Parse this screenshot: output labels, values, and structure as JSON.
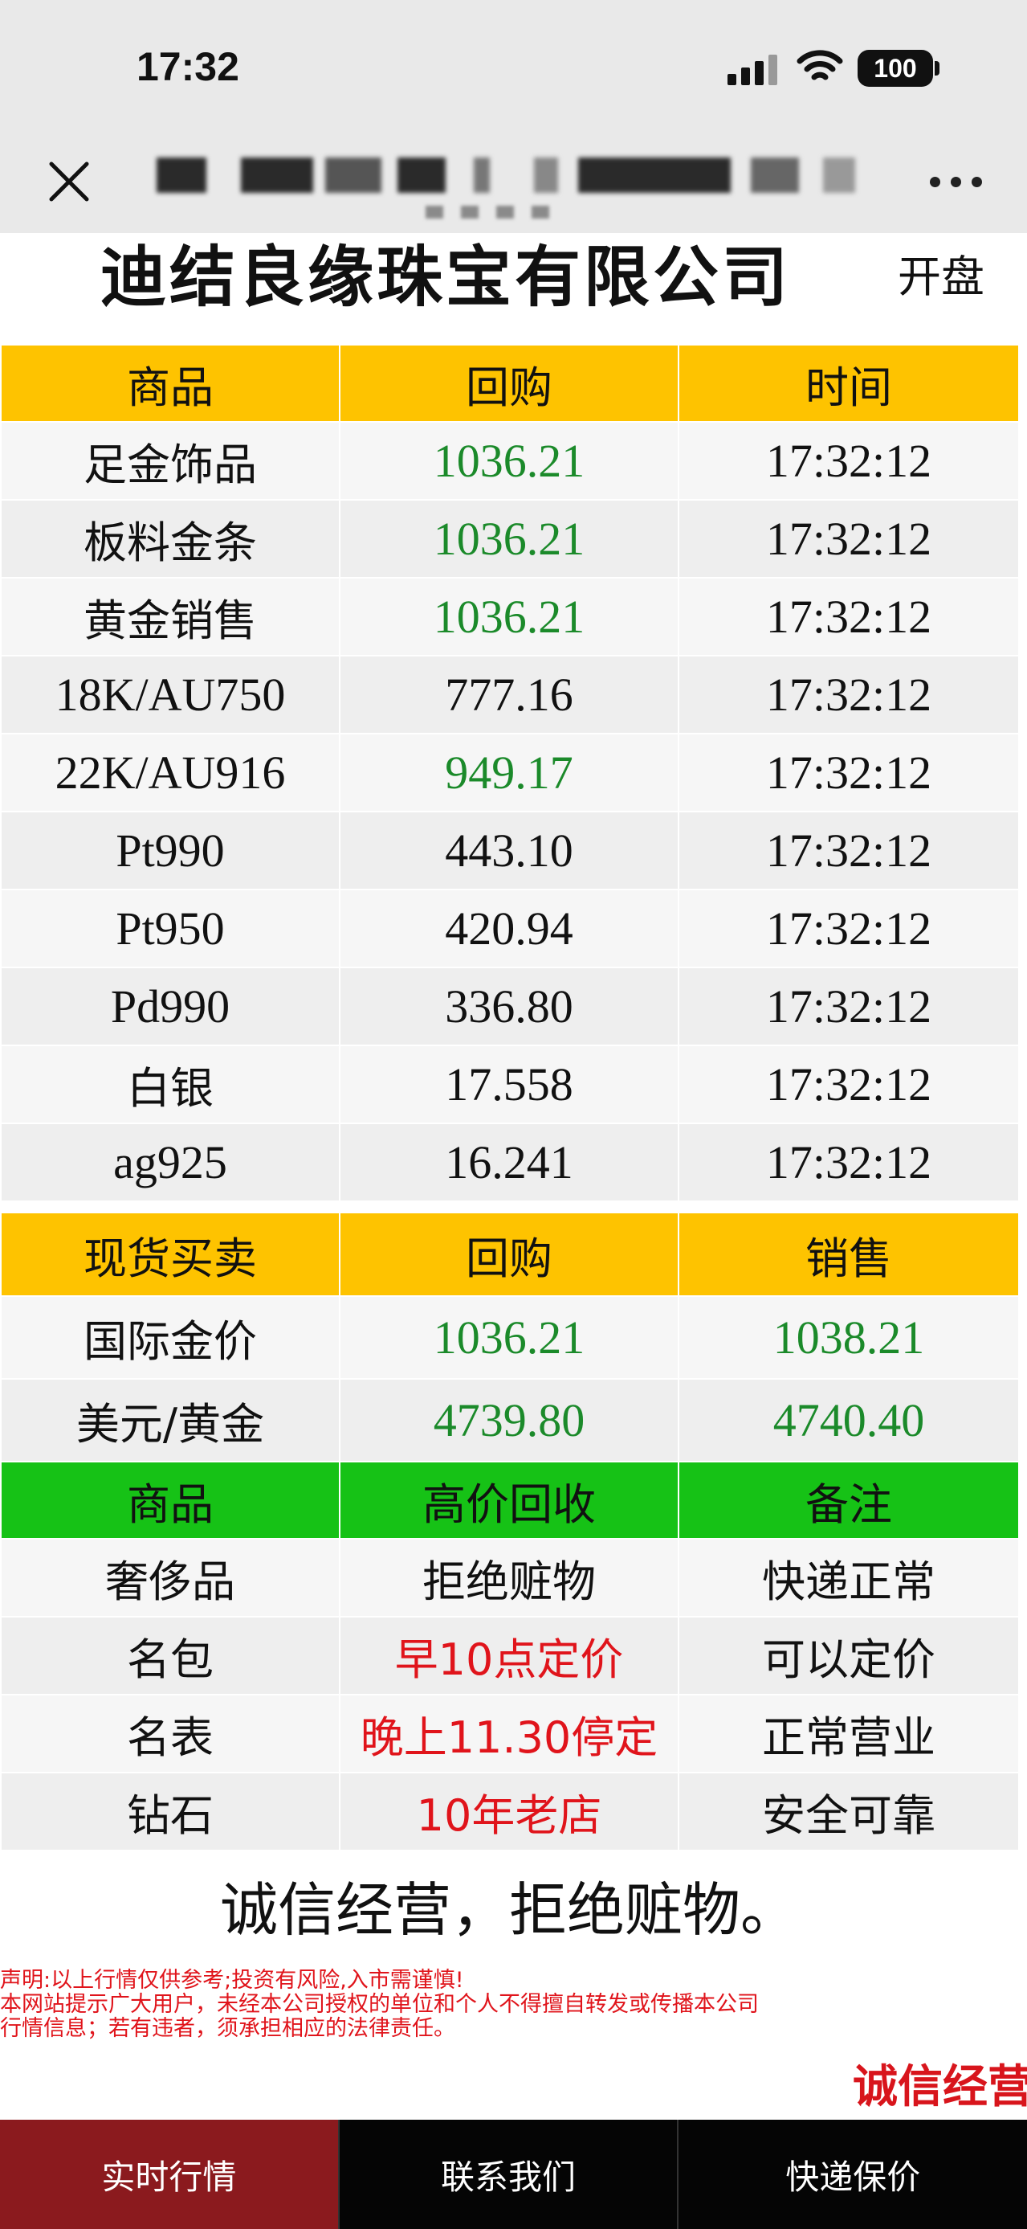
{
  "status_bar": {
    "time": "17:32",
    "battery": "100"
  },
  "header": {
    "company_name": "迪结良缘珠宝有限公司",
    "market_status": "开盘"
  },
  "price_table": {
    "headers": [
      "商品",
      "回购",
      "时间"
    ],
    "rows": [
      {
        "name": "足金饰品",
        "buyback": "1036.21",
        "time": "17:32:12",
        "color": "#1b8a2a"
      },
      {
        "name": "板料金条",
        "buyback": "1036.21",
        "time": "17:32:12",
        "color": "#1b8a2a"
      },
      {
        "name": "黄金销售",
        "buyback": "1036.21",
        "time": "17:32:12",
        "color": "#1b8a2a"
      },
      {
        "name": "18K/AU750",
        "buyback": "777.16",
        "time": "17:32:12",
        "color": "#111111"
      },
      {
        "name": "22K/AU916",
        "buyback": "949.17",
        "time": "17:32:12",
        "color": "#1b8a2a"
      },
      {
        "name": "Pt990",
        "buyback": "443.10",
        "time": "17:32:12",
        "color": "#111111"
      },
      {
        "name": "Pt950",
        "buyback": "420.94",
        "time": "17:32:12",
        "color": "#111111"
      },
      {
        "name": "Pd990",
        "buyback": "336.80",
        "time": "17:32:12",
        "color": "#111111"
      },
      {
        "name": "白银",
        "buyback": "17.558",
        "time": "17:32:12",
        "color": "#111111"
      },
      {
        "name": "ag925",
        "buyback": "16.241",
        "time": "17:32:12",
        "color": "#111111"
      }
    ]
  },
  "spot_table": {
    "headers": [
      "现货买卖",
      "回购",
      "销售"
    ],
    "rows": [
      {
        "name": "国际金价",
        "buyback": "1036.21",
        "sale": "1038.21"
      },
      {
        "name": "美元/黄金",
        "buyback": "4739.80",
        "sale": "4740.40"
      }
    ]
  },
  "recycle_table": {
    "headers": [
      "商品",
      "高价回收",
      "备注"
    ],
    "rows": [
      {
        "name": "奢侈品",
        "recycle": "拒绝赃物",
        "note": "快递正常",
        "recycle_color": "#111111"
      },
      {
        "name": "名包",
        "recycle": "早10点定价",
        "note": "可以定价",
        "recycle_color": "#e0141b"
      },
      {
        "name": "名表",
        "recycle": "晚上11.30停定",
        "note": "正常营业",
        "recycle_color": "#e0141b"
      },
      {
        "name": "钻石",
        "recycle": "10年老店",
        "note": "安全可靠",
        "recycle_color": "#e0141b"
      }
    ]
  },
  "footer": {
    "slogan": "诚信经营，拒绝赃物。",
    "disclaimer_lines": [
      "声明:以上行情仅供参考;投资有风险,入市需谨慎!",
      "本网站提示广大用户，未经本公司授权的单位和个人不得擅自转发或传播本公司",
      "行情信息；若有违者，须承担相应的法律责任。"
    ],
    "marquee": "诚信经营"
  },
  "bottom_nav": [
    "实时行情",
    "联系我们",
    "快递保价"
  ],
  "colors": {
    "header_yellow": "#fec300",
    "header_green": "#16c216",
    "active_tab": "#8b1a1e"
  }
}
